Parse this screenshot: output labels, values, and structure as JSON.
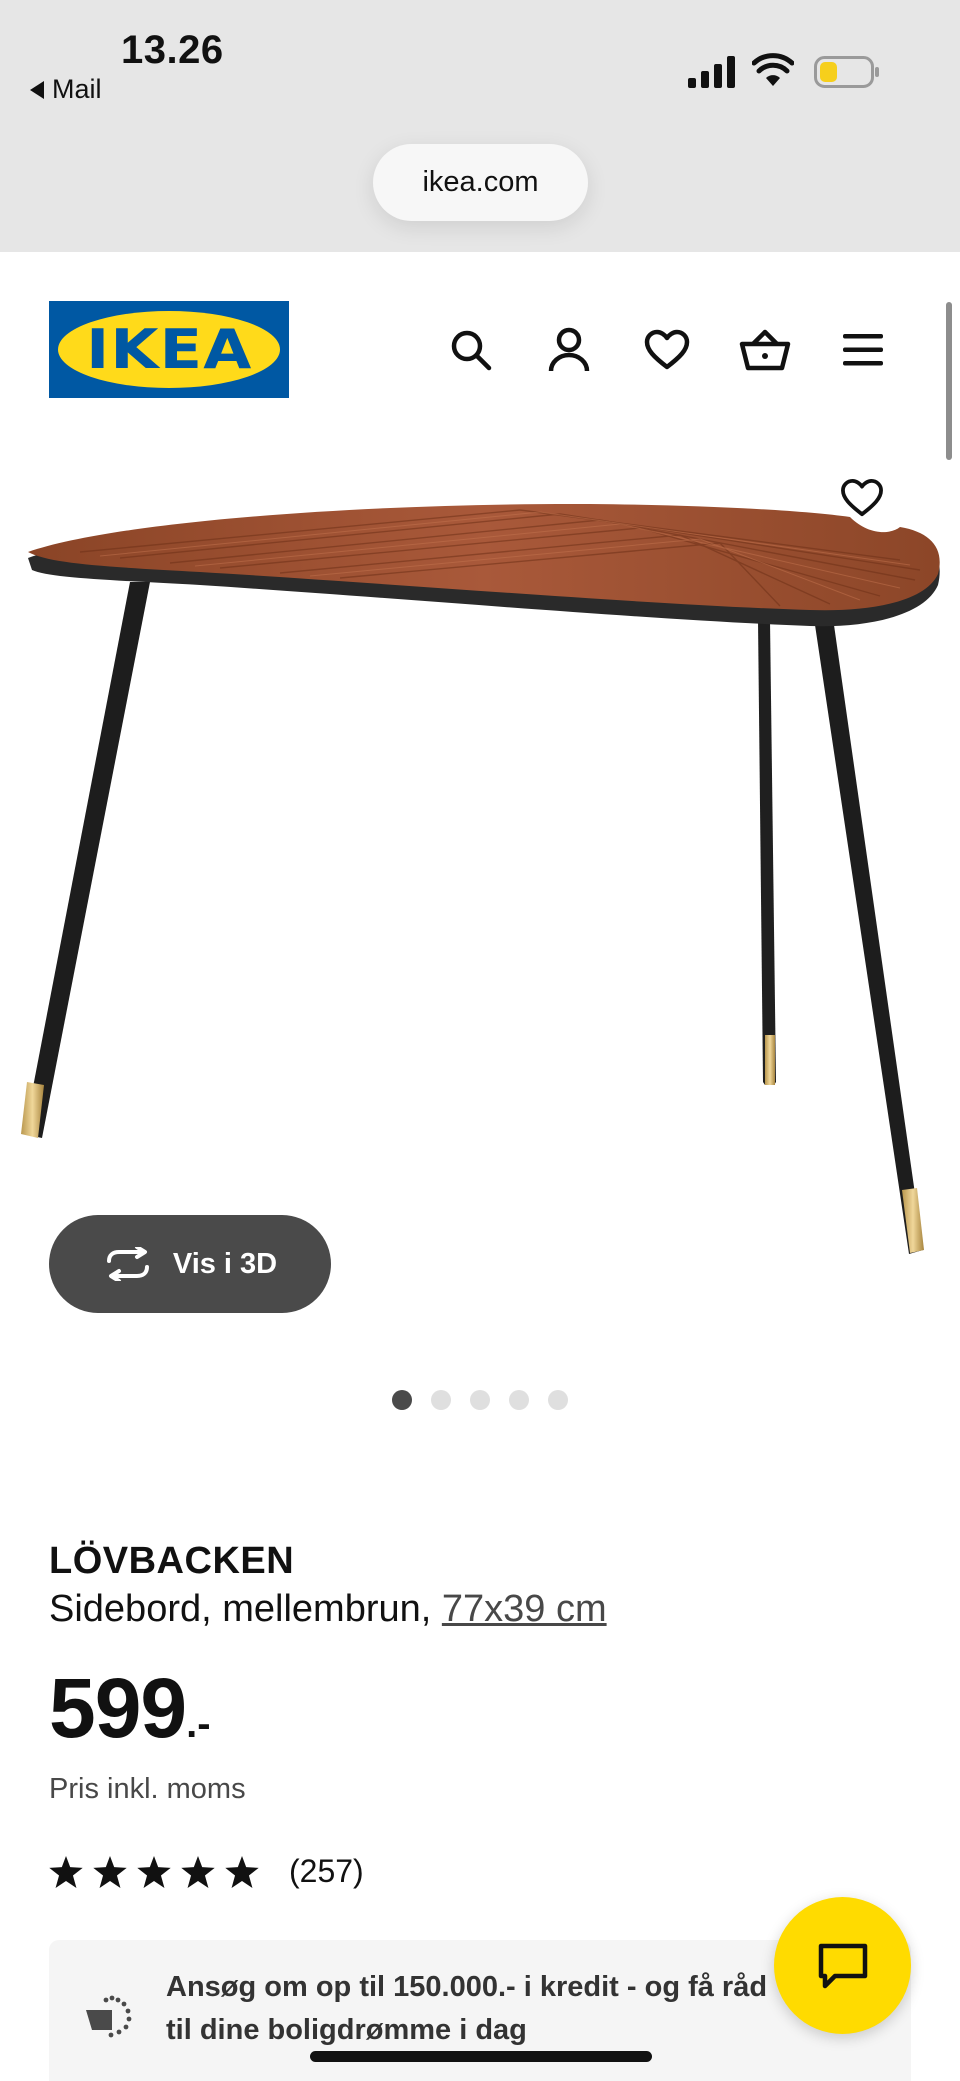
{
  "status_bar": {
    "time": "13.26",
    "back_label": "Mail"
  },
  "browser": {
    "url": "ikea.com"
  },
  "header": {
    "logo_text": "IKEA",
    "icons": [
      "search-icon",
      "account-icon",
      "favorites-icon",
      "basket-icon",
      "menu-icon"
    ]
  },
  "gallery": {
    "view_3d_label": "Vis i 3D",
    "slide_count": 5,
    "active_slide": 1
  },
  "product": {
    "name": "LÖVBACKEN",
    "description": "Sidebord, mellembrun, ",
    "dimensions": "77x39 cm",
    "price": "599",
    "price_suffix": ".-",
    "vat_note": "Pris inkl. moms",
    "rating_stars": 5,
    "review_count": "(257)"
  },
  "credit_banner": {
    "text": "Ansøg om op til 150.000.- i kredit - og få råd til dine boligdrømme i dag"
  },
  "colors": {
    "ikea_blue": "#0058a3",
    "ikea_yellow": "#ffda1a",
    "button_dark": "#4a4a4a",
    "chat_yellow": "#ffdb00"
  }
}
